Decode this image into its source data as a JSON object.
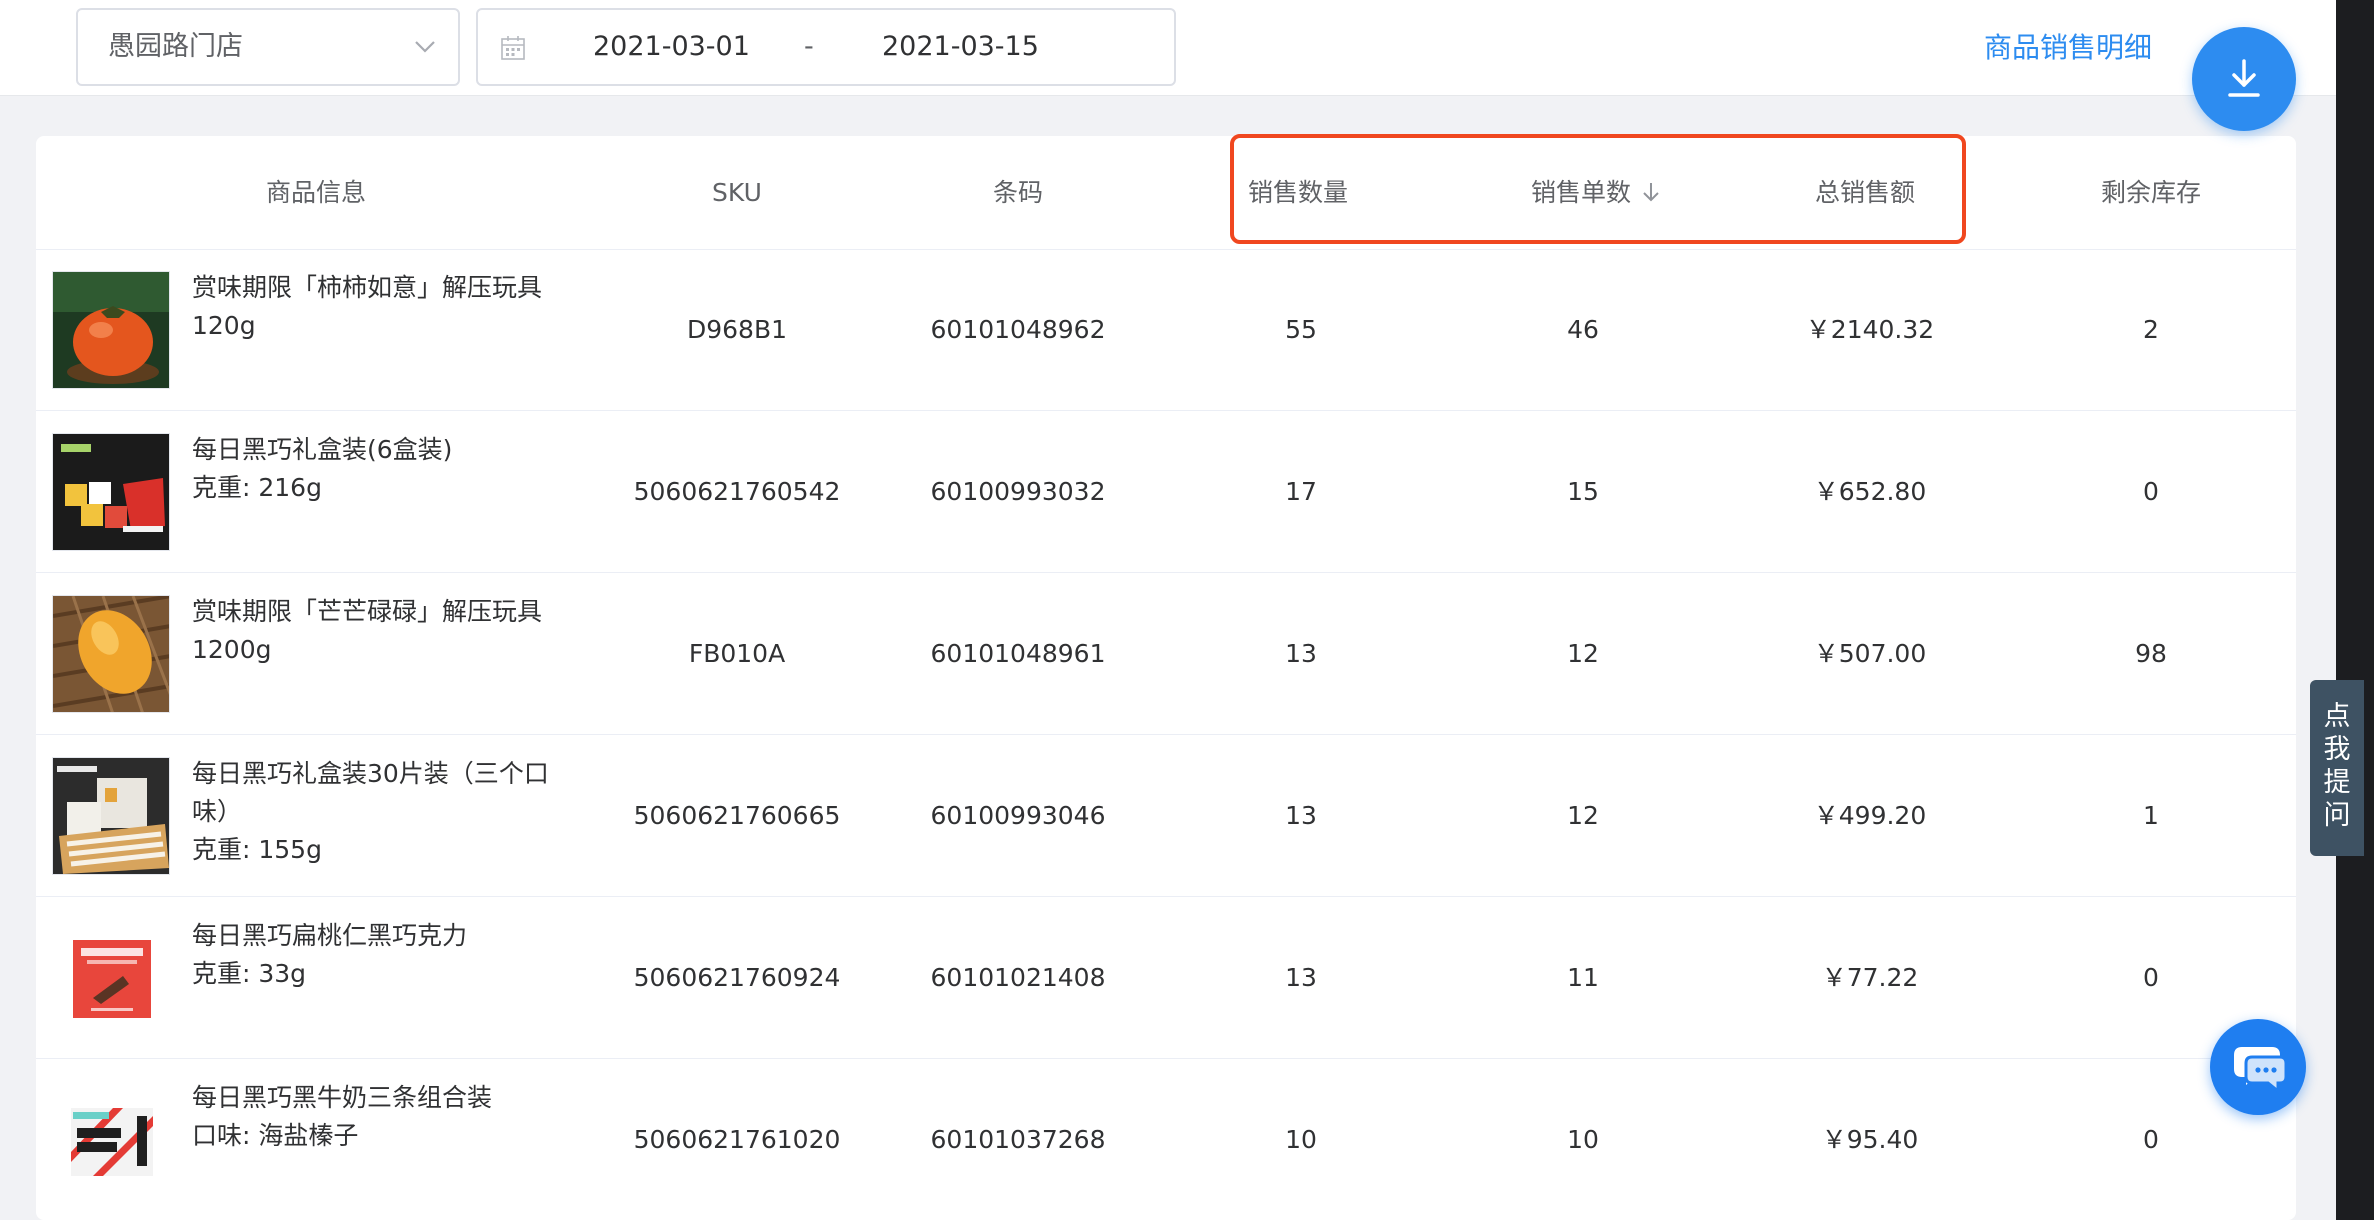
{
  "filters": {
    "store": "愚园路门店",
    "start_date": "2021-03-01",
    "separator": "-",
    "end_date": "2021-03-15",
    "detail_link": "商品销售明细"
  },
  "table": {
    "headers": {
      "product": "商品信息",
      "sku": "SKU",
      "barcode": "条码",
      "sales_qty": "销售数量",
      "order_count": "销售单数",
      "total_sales": "总销售额",
      "stock": "剩余库存"
    },
    "sorted_column": "销售单数",
    "sort_direction": "descending",
    "rows": [
      {
        "name_line1": "赏味期限「柿柿如意」解压玩具",
        "name_line2": "120g",
        "name_line3": "",
        "sku": "D968B1",
        "barcode": "60101048962",
        "sales_qty": "55",
        "order_count": "46",
        "total_sales": "￥2140.32",
        "stock": "2"
      },
      {
        "name_line1": "每日黑巧礼盒装(6盒装)",
        "name_line2": "克重: 216g",
        "name_line3": "",
        "sku": "5060621760542",
        "barcode": "60100993032",
        "sales_qty": "17",
        "order_count": "15",
        "total_sales": "￥652.80",
        "stock": "0"
      },
      {
        "name_line1": "赏味期限「芒芒碌碌」解压玩具",
        "name_line2": "1200g",
        "name_line3": "",
        "sku": "FB010A",
        "barcode": "60101048961",
        "sales_qty": "13",
        "order_count": "12",
        "total_sales": "￥507.00",
        "stock": "98"
      },
      {
        "name_line1": "每日黑巧礼盒装30片装（三个口",
        "name_line2": "味）",
        "name_line3": "克重: 155g",
        "sku": "5060621760665",
        "barcode": "60100993046",
        "sales_qty": "13",
        "order_count": "12",
        "total_sales": "￥499.20",
        "stock": "1"
      },
      {
        "name_line1": "每日黑巧扁桃仁黑巧克力",
        "name_line2": "克重: 33g",
        "name_line3": "",
        "sku": "5060621760924",
        "barcode": "60101021408",
        "sales_qty": "13",
        "order_count": "11",
        "total_sales": "￥77.22",
        "stock": "0"
      },
      {
        "name_line1": "每日黑巧黑牛奶三条组合装",
        "name_line2": "口味: 海盐榛子",
        "name_line3": "",
        "sku": "5060621761020",
        "barcode": "60101037268",
        "sales_qty": "10",
        "order_count": "10",
        "total_sales": "￥95.40",
        "stock": "0"
      }
    ]
  },
  "ask_tab": {
    "c1": "点",
    "c2": "我",
    "c3": "提",
    "c4": "问"
  },
  "icons": {
    "download": "download-icon",
    "chat": "chat-icon",
    "calendar": "calendar-icon",
    "dropdown": "chevron-down-icon",
    "sort": "arrow-down-icon"
  },
  "colors": {
    "accent": "#2d8cf0",
    "highlight": "#f0471f",
    "ask_tab": "#3e5263"
  }
}
